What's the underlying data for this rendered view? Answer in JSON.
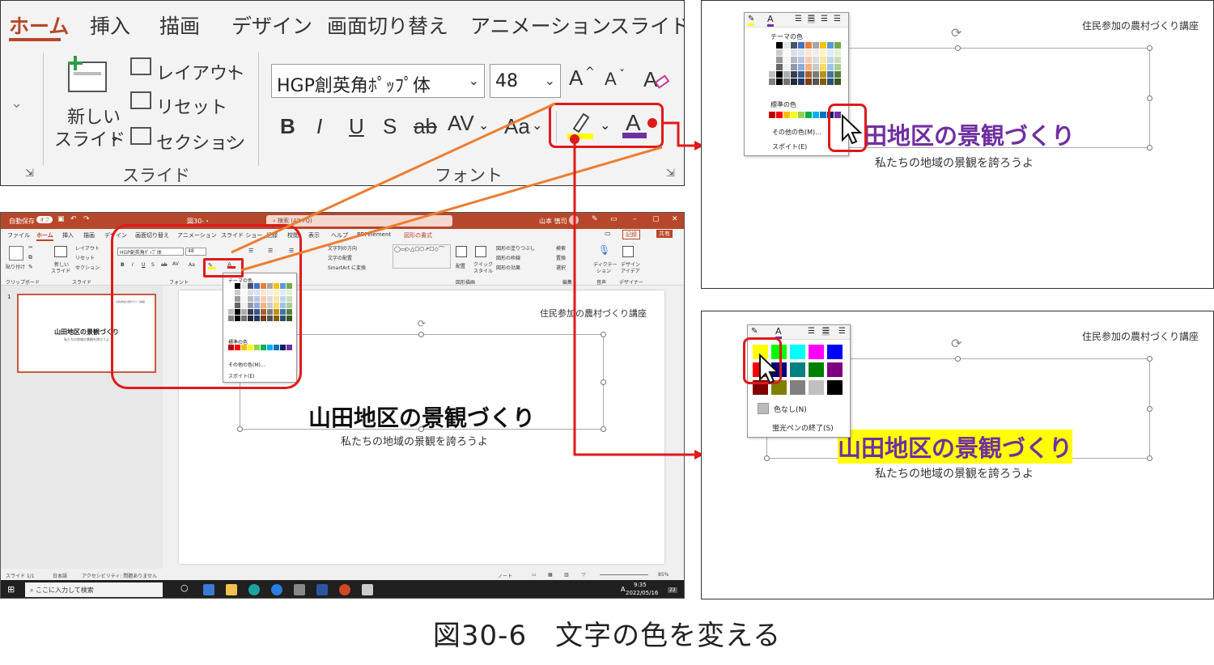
{
  "zoom_ribbon": {
    "tabs": [
      "ホーム",
      "挿入",
      "描画",
      "デザイン",
      "画面切り替え",
      "アニメーション",
      "スライド シ"
    ],
    "new_slide": [
      "新しい",
      "スライド"
    ],
    "layout": "レイアウト",
    "reset": "リセット",
    "section": "セクション",
    "slides_group": "スライド",
    "font_name": "HGP創英角ﾎﾟｯﾌﾟ体",
    "font_size": "48",
    "font_group": "フォント",
    "bold": "B",
    "italic": "I",
    "underline": "U",
    "shadow": "S",
    "strike": "ab",
    "spacing": "AV",
    "case": "Aa",
    "grow": "A",
    "shrink": "A",
    "highlight_color": "#ffff00",
    "font_color": "#7030a0"
  },
  "ppt_window": {
    "autosave": "自動保存",
    "autosave_state": "オフ",
    "doc_name": "図30-・",
    "search_placeholder": "検索 (Alt+Q)",
    "user": "山本 慎司",
    "menu": [
      "ファイル",
      "ホーム",
      "挿入",
      "描画",
      "デザイン",
      "画面切り替え",
      "アニメーション",
      "スライド ショー",
      "記録",
      "校閲",
      "表示",
      "ヘルプ",
      "PDFelement",
      "図形の書式"
    ],
    "record_btn": "記録",
    "share_btn": "共有",
    "ribbon": {
      "paste": "貼り付け",
      "new_slide": [
        "新しい",
        "スライド"
      ],
      "layout": "レイアウト",
      "reset": "リセット",
      "section": "セクション",
      "clipboard": "クリップボード",
      "slides": "スライド",
      "font": "フォント",
      "font_name": "HGP創英角ﾎﾟｯﾌﾟ体",
      "font_size": "48",
      "text_direction": "文字列の方向",
      "align_text": "文字の配置",
      "smartart": "SmartArt に変換",
      "arrange": "配置",
      "quick_styles": [
        "クイック",
        "スタイル"
      ],
      "shape_fill": "図形の塗りつぶし",
      "shape_outline": "図形の枠線",
      "shape_effects": "図形の効果",
      "shapes_group": "図形描画",
      "find": "検索",
      "replace": "置換",
      "select": "選択",
      "edit_group": "編集",
      "dictate": [
        "ディクテー",
        "ション"
      ],
      "voice_group": "音声",
      "designer": [
        "デザイン",
        "アイデア"
      ],
      "designer_group": "デザイナー"
    },
    "slide_number": "1",
    "slide": {
      "header": "住民参加の農村づくり講座",
      "title": "山田地区の景観づくり",
      "subtitle": "私たちの地域の景観を誇ろうよ"
    },
    "palette": {
      "theme_label": "テーマの色",
      "standard_label": "標準の色",
      "more_colors": "その他の色(M)...",
      "eyedropper": "スポイト(E)"
    },
    "status": {
      "slide_count": "スライド 1/1",
      "language": "日本語",
      "accessibility": "アクセシビリティ: 問題ありません",
      "notes": "ノート",
      "zoom": "85%"
    },
    "taskbar": {
      "search": "ここに入力して検索",
      "time": "9:35",
      "date": "2022/05/16",
      "ime": "A",
      "notif": "22"
    }
  },
  "panel_top": {
    "header": "住民参加の農村づくり講座",
    "title_visible": "田地区の景観づくり",
    "subtitle": "私たちの地域の景観を誇ろうよ",
    "palette": {
      "theme_label": "テーマの色",
      "standard_label": "標準の色",
      "more_colors": "その他の色(M)...",
      "eyedropper": "スポイト(E)"
    },
    "selected_color": "#7030a0"
  },
  "panel_bottom": {
    "header": "住民参加の農村づくり講座",
    "title": "山田地区の景観づくり",
    "subtitle": "私たちの地域の景観を誇ろうよ",
    "no_color": "色なし(N)",
    "end_highlighter": "蛍光ペンの終了(S)",
    "selected_color": "#ffff00"
  },
  "caption": "図30-6　文字の色を変える",
  "colors": {
    "accent_red": "#e01a1a",
    "connector_orange": "#ed7d31",
    "ppt_brand": "#b7472a",
    "highlight_yellow": "#ffff00",
    "title_purple": "#7030a0"
  }
}
